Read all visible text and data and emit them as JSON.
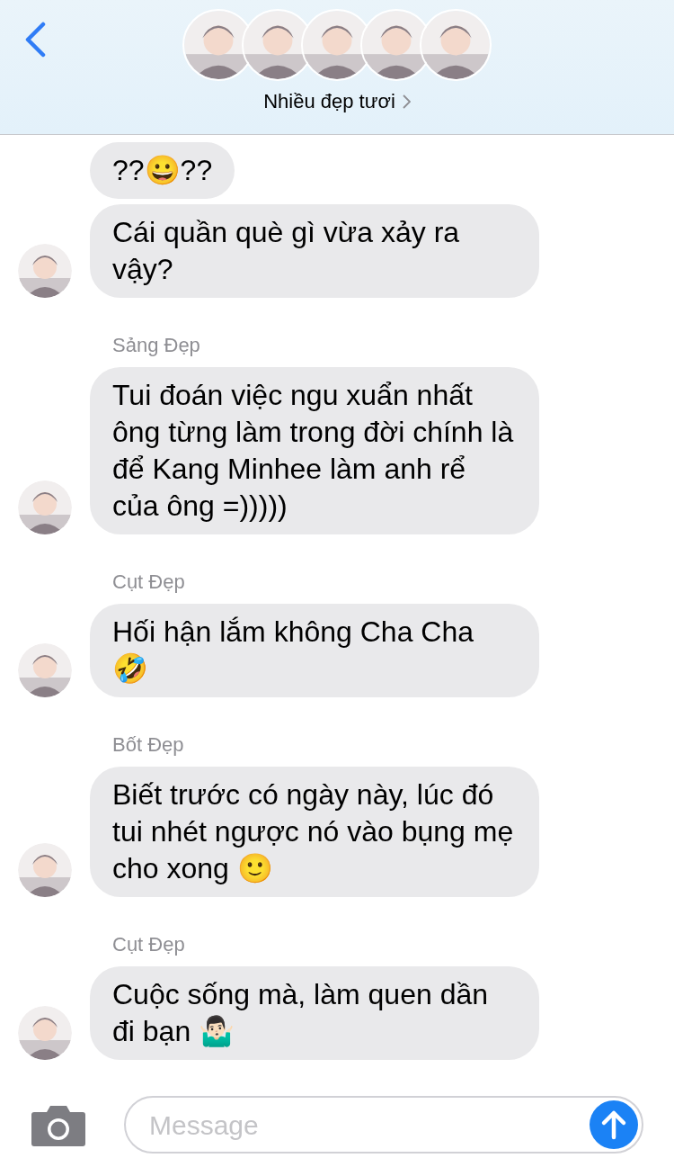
{
  "header": {
    "title": "Nhiều đẹp tươi"
  },
  "messages": [
    {
      "text": "??😀??",
      "show_avatar": false
    },
    {
      "text": "Cái quần què gì vừa xảy ra vậy?",
      "show_avatar": true
    },
    {
      "sender": "Sảng Đẹp",
      "text": "Tui đoán việc ngu xuẩn nhất ông từng làm trong đời chính là để Kang Minhee làm anh rể của ông =)))))",
      "show_avatar": true
    },
    {
      "sender": "Cụt Đẹp",
      "text": "Hối hận lắm không Cha Cha 🤣",
      "show_avatar": true
    },
    {
      "sender": "Bốt Đẹp",
      "text": "Biết trước có ngày này, lúc đó tui nhét ngược nó vào bụng mẹ cho xong 🙂",
      "show_avatar": true
    },
    {
      "sender": "Cụt Đẹp",
      "text": "Cuộc sống mà, làm quen dần đi bạn 🤷🏻‍♂️",
      "show_avatar": true
    }
  ],
  "composer": {
    "placeholder": "Message"
  }
}
